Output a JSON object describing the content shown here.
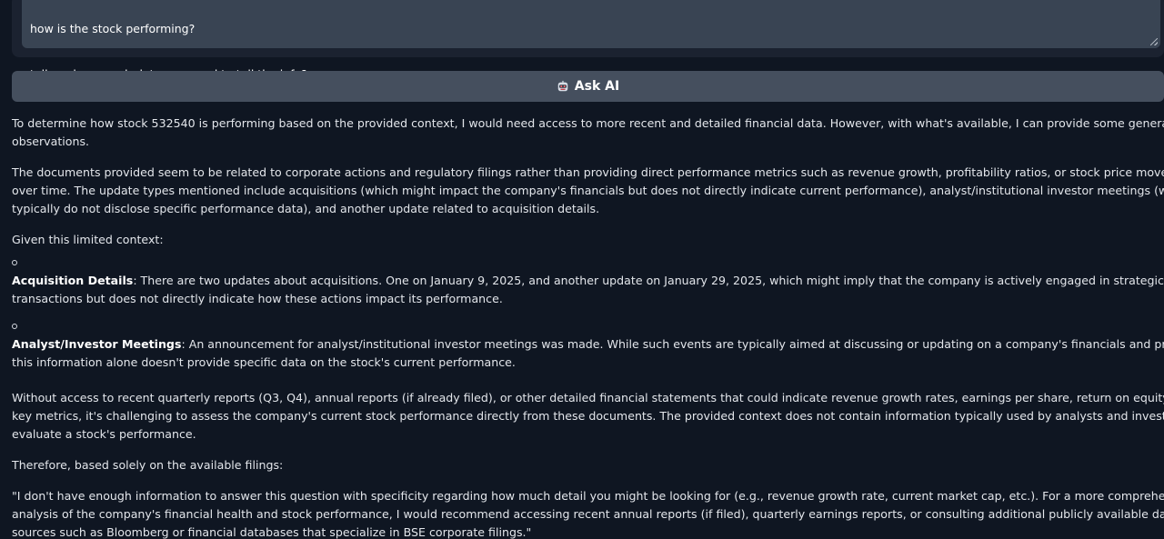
{
  "prompt": {
    "line1": "how is the stock performing?",
    "line2": "tell me how much data you need to tell the info?"
  },
  "ask_button": {
    "icon": "robot-icon",
    "label": "Ask AI"
  },
  "answer": {
    "intro": [
      "To determine how stock 532540 is performing based on the provided context, I would need access to more recent and detailed financial data. However, with what's available, I can provide some general",
      "observations."
    ],
    "documents": [
      "The documents provided seem to be related to corporate actions and regulatory filings rather than providing direct performance metrics such as revenue growth, profitability ratios, or stock price movements",
      "over time. The update types mentioned include acquisitions (which might impact the company's financials but does not directly indicate current performance), analyst/institutional investor meetings (which",
      "typically do not disclose specific performance data), and another update related to acquisition details."
    ],
    "given_context": "Given this limited context:",
    "bullets": [
      {
        "title": "Acquisition Details",
        "text_line1": ": There are two updates about acquisitions. One on January 9, 2025, and another update on January 29, 2025, which might imply that the company is actively engaged in strategic",
        "text_line2": "transactions but does not directly indicate how these actions impact its performance."
      },
      {
        "title": "Analyst/Investor Meetings",
        "text_line1": ": An announcement for analyst/institutional investor meetings was made. While such events are typically aimed at discussing or updating on a company's financials and prospects,",
        "text_line2": "this information alone doesn't provide specific data on the stock's current performance."
      }
    ],
    "without_access": [
      "Without access to recent quarterly reports (Q3, Q4), annual reports (if already filed), or other detailed financial statements that could indicate revenue growth rates, earnings per share, return on equity, or other",
      "key metrics, it's challenging to assess the company's current stock performance directly from these documents. The provided context does not contain information typically used by analysts and investors to",
      "evaluate a stock's performance."
    ],
    "therefore": "Therefore, based solely on the available filings:",
    "quote": [
      "\"I don't have enough information to answer this question with specificity regarding how much detail you might be looking for (e.g., revenue growth rate, current market cap, etc.). For a more comprehensive",
      "analysis of the company's financial health and stock performance, I would recommend accessing recent annual reports (if filed), quarterly earnings reports, or consulting additional publicly available data",
      "sources such as Bloomberg or financial databases that specialize in BSE corporate filings.\""
    ]
  }
}
